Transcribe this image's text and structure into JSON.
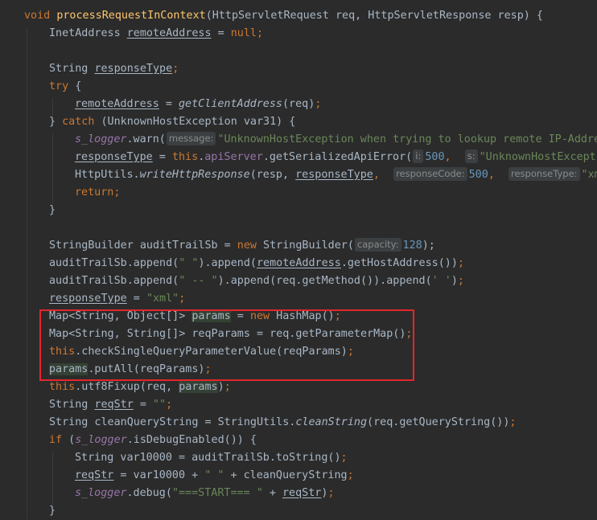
{
  "code": {
    "l1": {
      "kw_void": "void",
      "method": "processRequestInContext",
      "p1": "(HttpServletRequest req, HttpServletResponse resp) {"
    },
    "l2": {
      "type": "InetAddress ",
      "var": "remoteAddress",
      "eq": " = ",
      "kw_null": "null",
      "semi": ";"
    },
    "l4": {
      "type": "String ",
      "var": "responseType",
      "semi": ";"
    },
    "l5": {
      "kw_try": "try",
      "brace": " {"
    },
    "l6": {
      "var": "remoteAddress",
      "eq": " = ",
      "call": "getClientAddress",
      "args": "(req)",
      "semi": ";"
    },
    "l7": {
      "close": "} ",
      "kw_catch": "catch",
      "rest": " (UnknownHostException var31) {"
    },
    "l8": {
      "logger": "s_logger",
      "call": ".warn(",
      "hint": "message:",
      "str": "\"UnknownHostException when trying to lookup remote IP-Addre"
    },
    "l9": {
      "var": "responseType",
      "eq": " = ",
      "kw_this": "this",
      "dot": ".",
      "fld": "apiServer",
      "call": ".getSerializedApiError(",
      "hint1": "i:",
      "num": "500",
      "comma": ",  ",
      "hint2": "s:",
      "str": "\"UnknownHostExcepti"
    },
    "l10": {
      "cls": "HttpUtils.",
      "call": "writeHttpResponse",
      "args1": "(resp, ",
      "var": "responseType",
      "comma": ",  ",
      "hint1": "responseCode:",
      "num": "500",
      "comma2": ",  ",
      "hint2": "responseType:",
      "str": "\"xm"
    },
    "l11": {
      "kw_return": "return",
      "semi": ";"
    },
    "l12": {
      "close": "}"
    },
    "l14": {
      "t1": "StringBuilder auditTrailSb = ",
      "kw_new": "new",
      "t2": " StringBuilder(",
      "hint": "capacity:",
      "num": "128",
      "t3": ");"
    },
    "l15": {
      "t1": "auditTrailSb.append(",
      "str": "\" \"",
      "t2": ").append(",
      "var": "remoteAddress",
      "t3": ".getHostAddress())",
      "semi": ";"
    },
    "l16": {
      "t1": "auditTrailSb.append(",
      "str": "\" -- \"",
      "t2": ").append(req.getMethod()).append(",
      "chr": "' '",
      "t3": ")",
      "semi": ";"
    },
    "l17": {
      "var": "responseType",
      "eq": " = ",
      "str": "\"xml\"",
      "semi": ";"
    },
    "l18": {
      "t1": "Map<String, Object[]> ",
      "var": "params",
      "eq": " = ",
      "kw_new": "new",
      "t2": " HashMap()",
      "semi": ";"
    },
    "l19": {
      "t1": "Map<String, String[]> reqParams = req.getParameterMap()",
      "semi": ";"
    },
    "l20": {
      "kw_this": "this",
      "t1": ".checkSingleQueryParameterValue(reqParams)",
      "semi": ";"
    },
    "l21": {
      "var": "params",
      "t1": ".putAll(reqParams)",
      "semi": ";"
    },
    "l22": {
      "kw_this": "this",
      "t1": ".utf8Fixup(req, ",
      "var": "params",
      "t2": ")",
      "semi": ";"
    },
    "l23": {
      "t1": "String ",
      "var": "reqStr",
      "eq": " = ",
      "str": "\"\"",
      "semi": ";"
    },
    "l24": {
      "t1": "String cleanQueryString = StringUtils.",
      "call": "cleanString",
      "t2": "(req.getQueryString())",
      "semi": ";"
    },
    "l25": {
      "kw_if": "if",
      "t1": " (",
      "logger": "s_logger",
      "t2": ".isDebugEnabled()) {"
    },
    "l26": {
      "t1": "String var10000 = auditTrailSb.toString()",
      "semi": ";"
    },
    "l27": {
      "var": "reqStr",
      "t1": " = var10000 + ",
      "str": "\" \"",
      "t2": " + cleanQueryString",
      "semi": ";"
    },
    "l28": {
      "logger": "s_logger",
      "t1": ".debug(",
      "str": "\"===START=== \"",
      "t2": " + ",
      "var": "reqStr",
      "t3": ")",
      "semi": ";"
    },
    "l29": {
      "close": "}"
    }
  },
  "colors": {
    "background": "#2b2b2b",
    "keyword": "#cc7832",
    "method_decl": "#ffc66d",
    "string": "#6a8759",
    "number": "#6897bb",
    "field": "#9876aa",
    "highlight_box": "#e4262b"
  }
}
